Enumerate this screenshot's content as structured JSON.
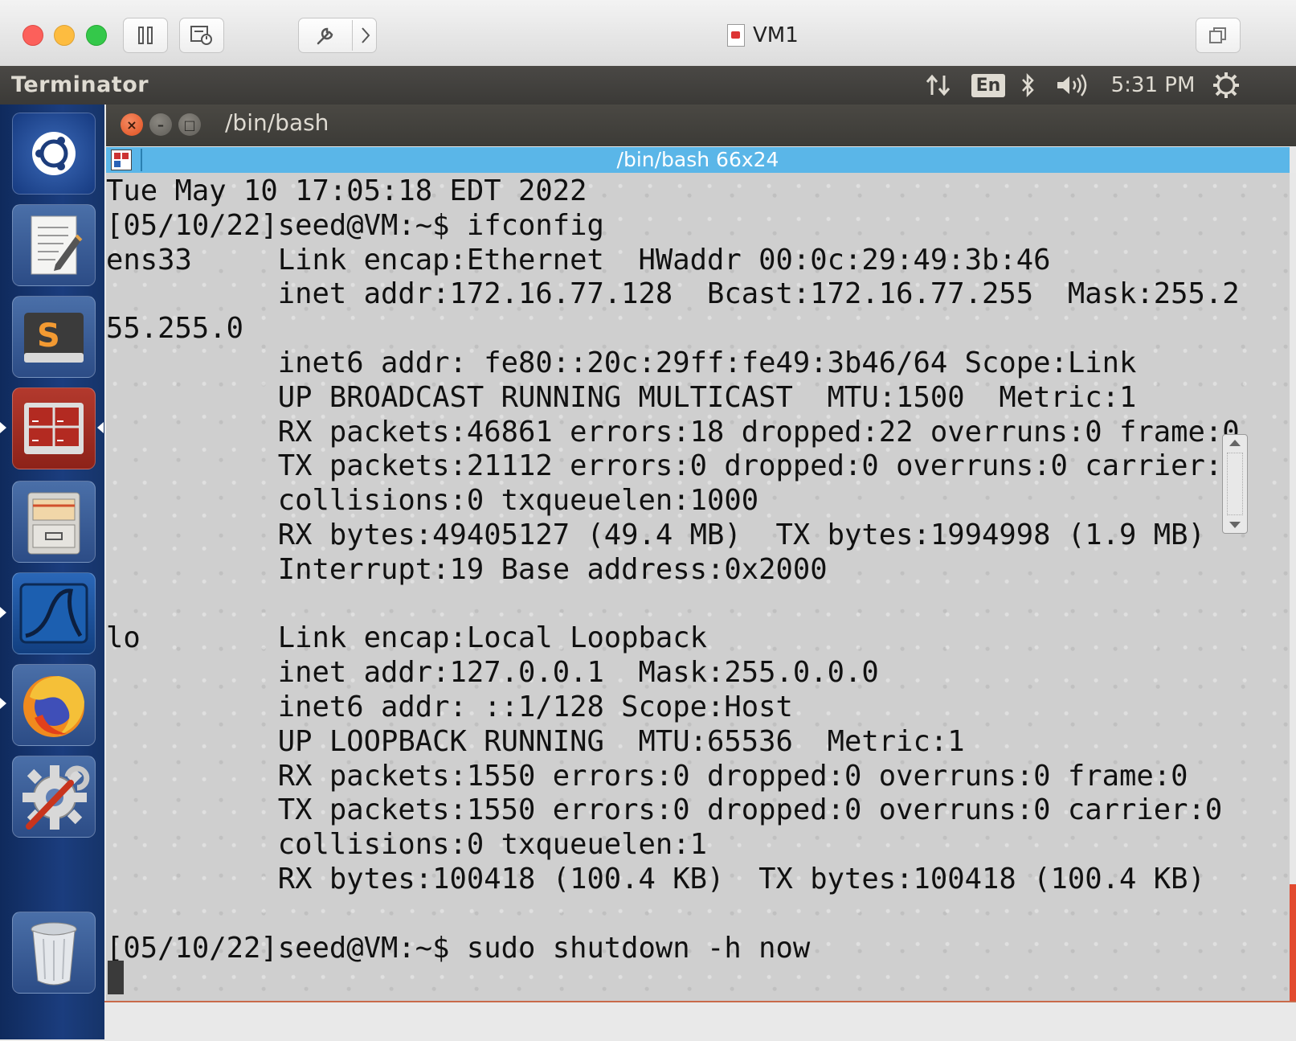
{
  "host": {
    "window_title": "VM1"
  },
  "panel": {
    "app_name": "Terminator",
    "lang": "En",
    "time": "5:31 PM"
  },
  "launcher": {
    "items": [
      "ubuntu-dash",
      "text-editor",
      "sublime-text",
      "terminator",
      "files",
      "wireshark",
      "firefox",
      "system-settings",
      "trash"
    ]
  },
  "terminal": {
    "window_title": "/bin/bash",
    "tab_title": "/bin/bash 66x24",
    "output": "Tue May 10 17:05:18 EDT 2022\n[05/10/22]seed@VM:~$ ifconfig\nens33     Link encap:Ethernet  HWaddr 00:0c:29:49:3b:46\n          inet addr:172.16.77.128  Bcast:172.16.77.255  Mask:255.2\n55.255.0\n          inet6 addr: fe80::20c:29ff:fe49:3b46/64 Scope:Link\n          UP BROADCAST RUNNING MULTICAST  MTU:1500  Metric:1\n          RX packets:46861 errors:18 dropped:22 overruns:0 frame:0\n          TX packets:21112 errors:0 dropped:0 overruns:0 carrier:0\n          collisions:0 txqueuelen:1000\n          RX bytes:49405127 (49.4 MB)  TX bytes:1994998 (1.9 MB)\n          Interrupt:19 Base address:0x2000\n\nlo        Link encap:Local Loopback\n          inet addr:127.0.0.1  Mask:255.0.0.0\n          inet6 addr: ::1/128 Scope:Host\n          UP LOOPBACK RUNNING  MTU:65536  Metric:1\n          RX packets:1550 errors:0 dropped:0 overruns:0 frame:0\n          TX packets:1550 errors:0 dropped:0 overruns:0 carrier:0\n          collisions:0 txqueuelen:1\n          RX bytes:100418 (100.4 KB)  TX bytes:100418 (100.4 KB)\n\n[05/10/22]seed@VM:~$ sudo shutdown -h now"
  },
  "colors": {
    "launcher_bg": "#1b3d7e",
    "panel_bg": "#3c3b37",
    "tab_bar": "#5ab6e8",
    "close_button": "#e0501f"
  }
}
